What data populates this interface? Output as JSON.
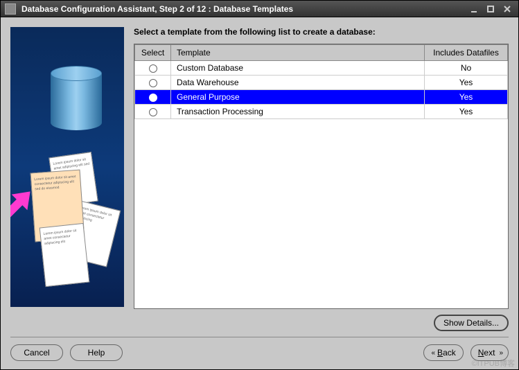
{
  "titlebar": {
    "title": "Database Configuration Assistant, Step 2 of 12 : Database Templates"
  },
  "instruction": "Select a template from the following list to create a database:",
  "columns": {
    "select": "Select",
    "template": "Template",
    "includes": "Includes Datafiles"
  },
  "rows": [
    {
      "selected": false,
      "template": "Custom Database",
      "includes": "No"
    },
    {
      "selected": false,
      "template": "Data Warehouse",
      "includes": "Yes"
    },
    {
      "selected": true,
      "template": "General Purpose",
      "includes": "Yes"
    },
    {
      "selected": false,
      "template": "Transaction Processing",
      "includes": "Yes"
    }
  ],
  "buttons": {
    "show_details": "Show Details...",
    "cancel": "Cancel",
    "help": "Help",
    "back": "Back",
    "next": "Next"
  },
  "watermark": "©ITPUB博客"
}
